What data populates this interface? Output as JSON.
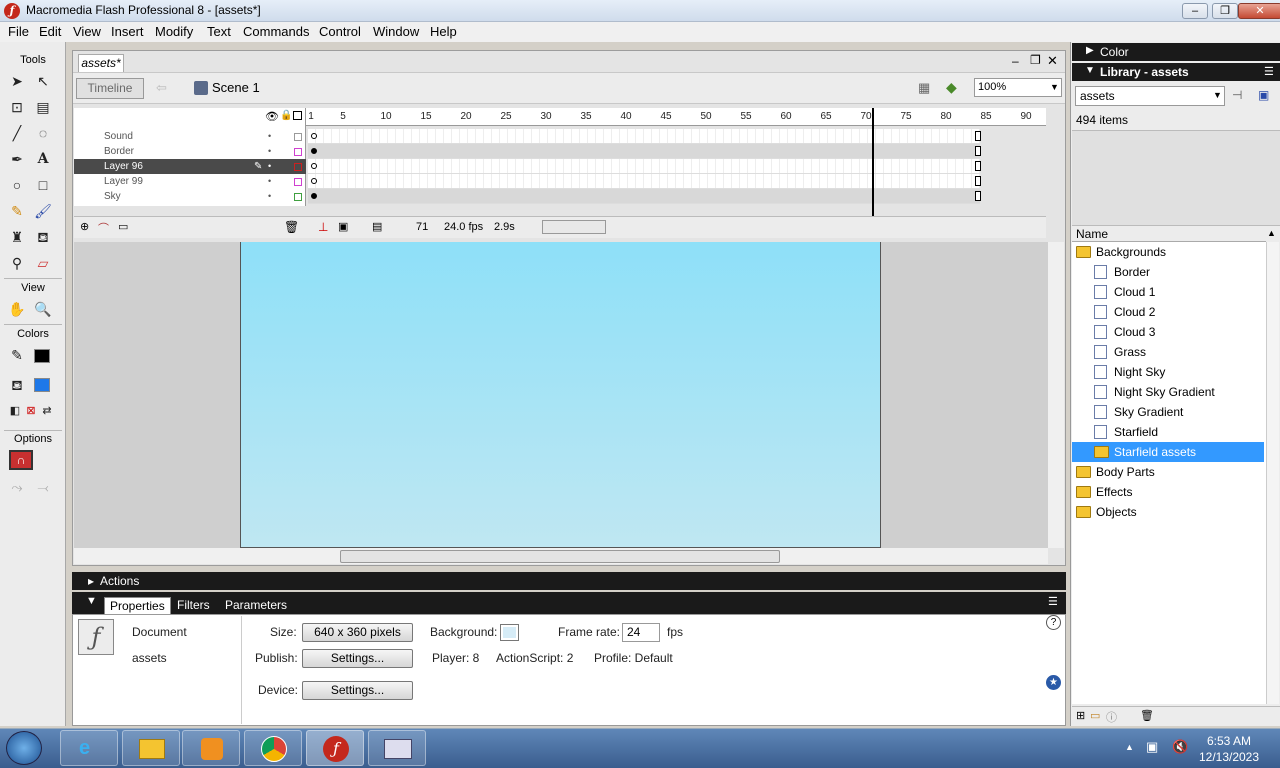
{
  "window": {
    "title": "Macromedia Flash Professional 8 - [assets*]",
    "minimize": "–",
    "restore": "❐",
    "close": "✕"
  },
  "menu": [
    "File",
    "Edit",
    "View",
    "Insert",
    "Modify",
    "Text",
    "Commands",
    "Control",
    "Window",
    "Help"
  ],
  "tools": {
    "title": "Tools",
    "view_label": "View",
    "colors_label": "Colors",
    "options_label": "Options"
  },
  "document": {
    "tab": "assets*",
    "timeline_btn": "Timeline",
    "scene": "Scene 1",
    "zoom": "100%"
  },
  "timeline": {
    "ruler": [
      "1",
      "5",
      "10",
      "15",
      "20",
      "25",
      "30",
      "35",
      "40",
      "45",
      "50",
      "55",
      "60",
      "65",
      "70",
      "75",
      "80",
      "85",
      "90"
    ],
    "layers": [
      {
        "name": "Sound",
        "selected": false
      },
      {
        "name": "Border",
        "selected": false
      },
      {
        "name": "Layer 96",
        "selected": true
      },
      {
        "name": "Layer 99",
        "selected": false
      },
      {
        "name": "Sky",
        "selected": false
      }
    ],
    "current_frame": "71",
    "fps": "24.0 fps",
    "elapsed": "2.9s"
  },
  "actions": {
    "label": "Actions"
  },
  "properties": {
    "tabs": [
      "Properties",
      "Filters",
      "Parameters"
    ],
    "doc_type": "Document",
    "doc_name": "assets",
    "size_label": "Size:",
    "size_value": "640 x 360 pixels",
    "background_label": "Background:",
    "background_color": "#d6ecf7",
    "framerate_label": "Frame rate:",
    "framerate_value": "24",
    "framerate_unit": "fps",
    "publish_label": "Publish:",
    "settings_btn": "Settings...",
    "player": "Player: 8",
    "actionscript": "ActionScript: 2",
    "profile": "Profile: Default",
    "device_label": "Device:",
    "device_btn": "Settings..."
  },
  "panels": {
    "color": "Color",
    "library": "Library - assets",
    "library_select": "assets",
    "item_count": "494 items",
    "name_header": "Name"
  },
  "library_items": [
    {
      "label": "Backgrounds",
      "type": "folder-open",
      "indent": 0,
      "selected": false
    },
    {
      "label": "Border",
      "type": "graphic",
      "indent": 1,
      "selected": false
    },
    {
      "label": "Cloud 1",
      "type": "graphic",
      "indent": 1,
      "selected": false
    },
    {
      "label": "Cloud 2",
      "type": "graphic",
      "indent": 1,
      "selected": false
    },
    {
      "label": "Cloud 3",
      "type": "graphic",
      "indent": 1,
      "selected": false
    },
    {
      "label": "Grass",
      "type": "graphic",
      "indent": 1,
      "selected": false
    },
    {
      "label": "Night Sky",
      "type": "graphic",
      "indent": 1,
      "selected": false
    },
    {
      "label": "Night Sky Gradient",
      "type": "graphic",
      "indent": 1,
      "selected": false
    },
    {
      "label": "Sky Gradient",
      "type": "graphic",
      "indent": 1,
      "selected": false
    },
    {
      "label": "Starfield",
      "type": "graphic",
      "indent": 1,
      "selected": false
    },
    {
      "label": "Starfield assets",
      "type": "folder",
      "indent": 1,
      "selected": true
    },
    {
      "label": "Body Parts",
      "type": "folder",
      "indent": 0,
      "selected": false
    },
    {
      "label": "Effects",
      "type": "folder",
      "indent": 0,
      "selected": false
    },
    {
      "label": "Objects",
      "type": "folder",
      "indent": 0,
      "selected": false
    }
  ],
  "taskbar": {
    "time": "6:53 AM",
    "date": "12/13/2023"
  }
}
